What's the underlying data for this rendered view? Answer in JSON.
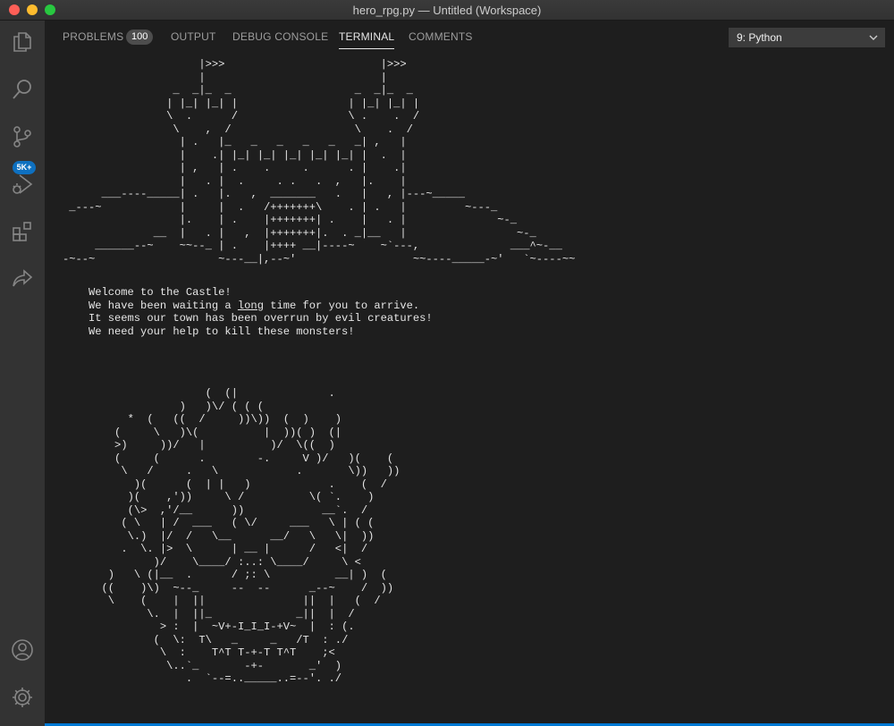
{
  "window": {
    "title": "hero_rpg.py — Untitled (Workspace)"
  },
  "activity_bar": {
    "items": [
      {
        "icon": "files-icon"
      },
      {
        "icon": "search-icon"
      },
      {
        "icon": "source-control-icon",
        "badge": "5K+"
      },
      {
        "icon": "run-debug-icon"
      },
      {
        "icon": "extensions-icon"
      },
      {
        "icon": "live-share-icon"
      }
    ],
    "bottom": [
      {
        "icon": "account-icon"
      },
      {
        "icon": "settings-gear-icon"
      }
    ]
  },
  "panel": {
    "tabs": [
      {
        "label": "PROBLEMS",
        "count": "100"
      },
      {
        "label": "OUTPUT"
      },
      {
        "label": "DEBUG CONSOLE"
      },
      {
        "label": "TERMINAL",
        "active": true
      },
      {
        "label": "COMMENTS"
      }
    ],
    "terminal_select": "9: Python"
  },
  "terminal": {
    "castle_art": "                     |>>>                        |>>>\n                     |                           |\n                 _  _|_  _                   _  _|_  _\n                | |_| |_| |                 | |_| |_| |\n                \\  .      /                 \\ .    .  /\n                 \\    ,  /                   \\    .  /\n                  | .   |_   _   _   _   _   _| ,   |\n                  |    .| |_| |_| |_| |_| |_| |  .  |\n                  | ,   | .    .     .      . |    .|\n                  |   . |  .     . .   .  ,   |.    |\n      ___----_____| .   |.   ,  _______   .   |   , |---~_____\n _---~            |     |  .   /+++++++\\    . | .   |         ~---_\n                  |.    | .    |+++++++| .    |   . |              ~-_\n              __  |   . |   ,  |+++++++|.  . _|__   |                 ~-_\n     ______--~    ~~--_ | .    |++++ __|----~    ~`---,              ___^~-__\n-~--~                   ~---__|,--~'                  ~~----_____-~'   `~----~~",
    "welcome_lines": [
      "Welcome to the Castle!",
      "We have been waiting a long time for you to arrive.",
      "It seems our town has been overrun by evil creatures!",
      "We need your help to kill these monsters!"
    ],
    "monster_art": "                      (  (|              .\n                  )   )\\/ ( ( (\n          *  (   ((  /     ))\\))  (  )    )\n        (     \\   )\\(          |  ))( )  (|\n        >)     ))/   |          )/  \\((  )\n        (     (      .        -.     V )/   )(    (\n         \\   /     .   \\            .       \\))   ))\n           )(      (  | |   )            .    (  /\n          )(    ,'))     \\ /          \\( `.    )\n          (\\>  ,'/__      ))            __`.  /\n         ( \\   | /  ___   ( \\/     ___   \\ | ( (\n          \\.)  |/  /   \\__      __/   \\   \\|  ))\n         .  \\. |>  \\      | __ |      /   <|  /\n              )/    \\____/ :..: \\____/     \\ <\n       )   \\ (|__  .      / ;: \\          __| )  (\n      ((    )\\)  ~--_     --  --      _--~    /  ))\n       \\    (    |  ||               ||  |   (  /\n             \\.  |  ||_             _||  |  /\n               > :  |  ~V+-I_I_I-+V~  |  : (.\n              (  \\:  T\\   _     _   /T  : ./\n               \\  :    T^T T-+-T T^T    ;<\n                \\..`_       -+-       _'  )\n                   .  `--=.._____..=--'. ./"
  }
}
